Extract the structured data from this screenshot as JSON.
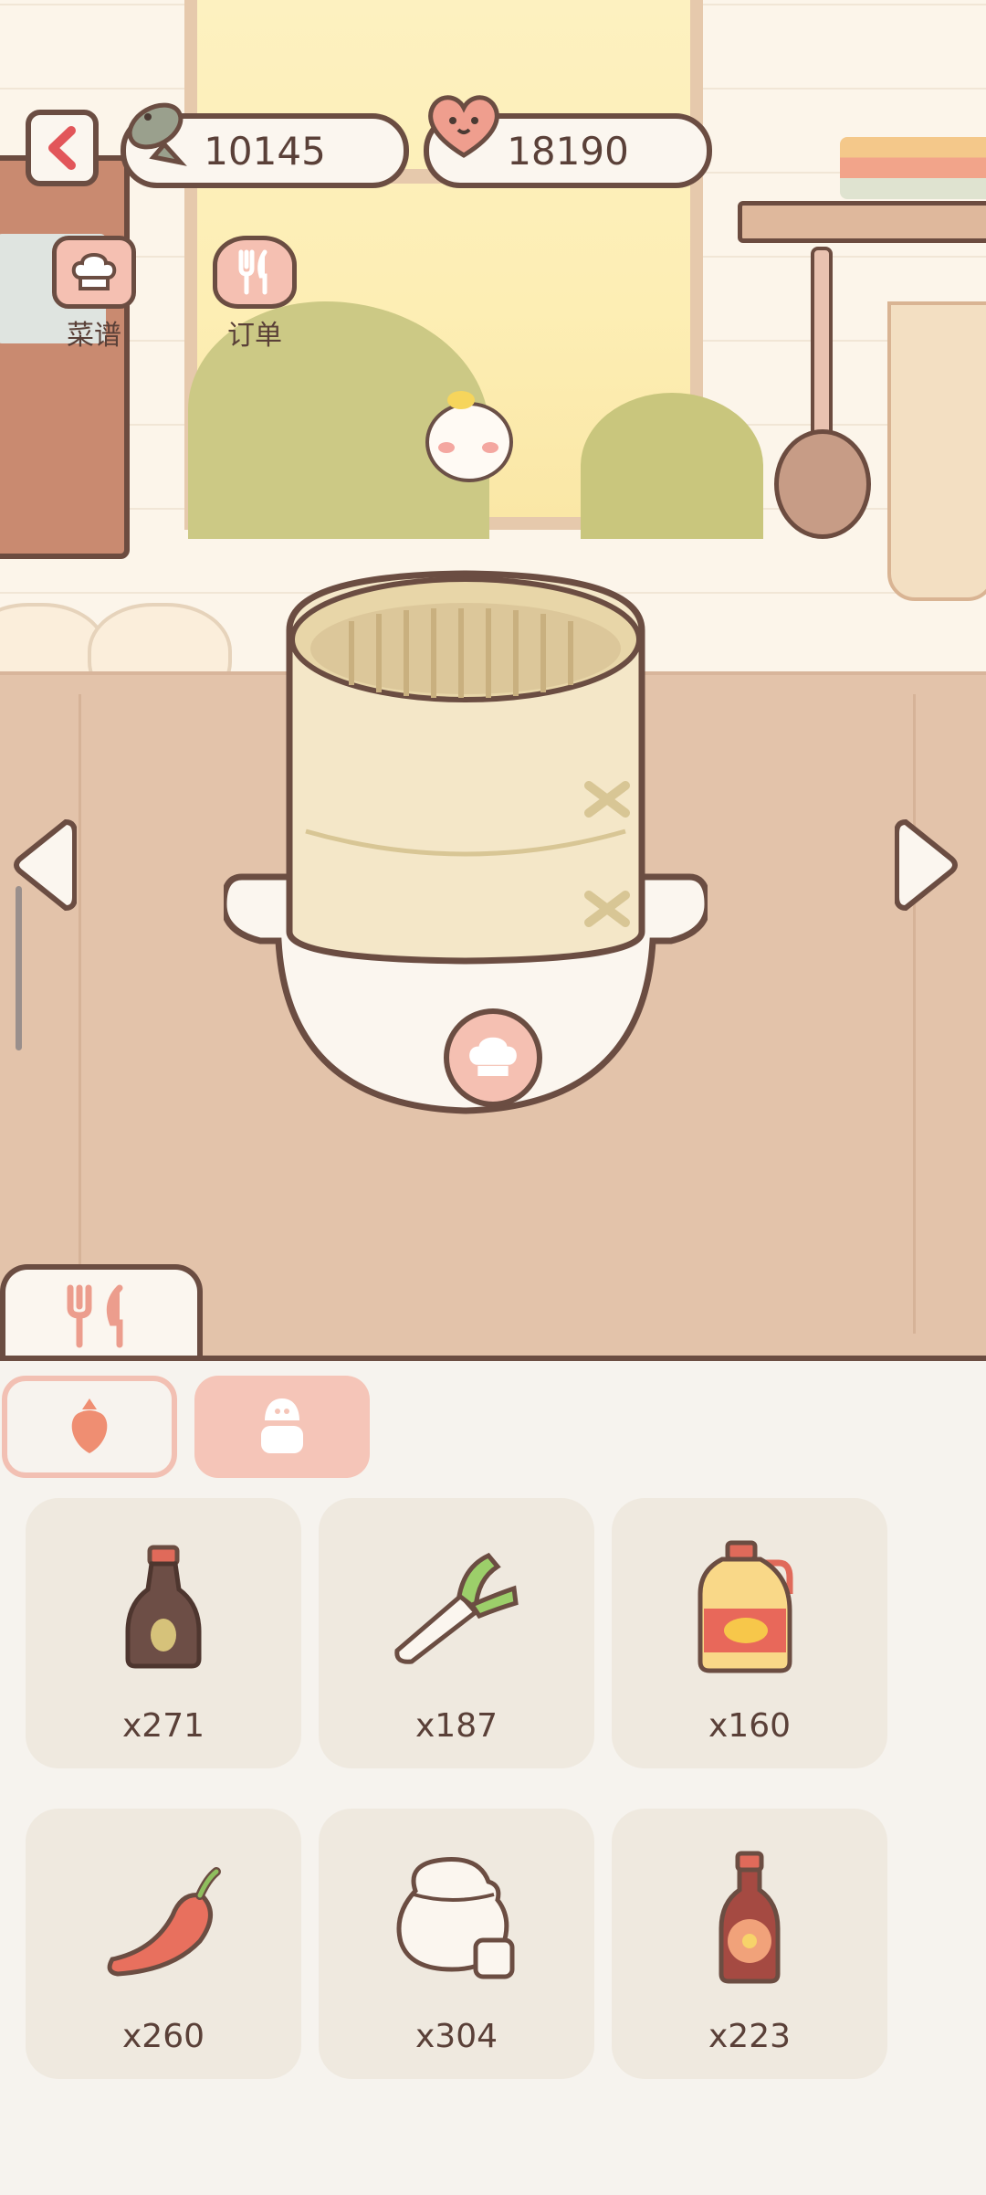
{
  "currency": {
    "fish": "10145",
    "hearts": "18190"
  },
  "quick_menu": [
    {
      "label": "菜谱",
      "icon": "chef-hat-icon"
    },
    {
      "label": "订单",
      "icon": "fork-knife-icon"
    }
  ],
  "categories": [
    {
      "icon": "carrot-icon",
      "selected": false
    },
    {
      "icon": "salt-shaker-icon",
      "selected": true
    }
  ],
  "ingredients": [
    {
      "icon": "soy-sauce-bottle-icon",
      "qty": "x271"
    },
    {
      "icon": "green-onion-icon",
      "qty": "x187"
    },
    {
      "icon": "cooking-oil-jug-icon",
      "qty": "x160"
    },
    {
      "icon": "chili-pepper-icon",
      "qty": "x260"
    },
    {
      "icon": "sugar-jar-icon",
      "qty": "x304"
    },
    {
      "icon": "sauce-bottle-icon",
      "qty": "x223"
    }
  ],
  "colors": {
    "outline": "#6b4d42",
    "accent_pink": "#f5c0b2",
    "panel_bg": "#f6f3ee",
    "counter": "#e3c3aa"
  }
}
